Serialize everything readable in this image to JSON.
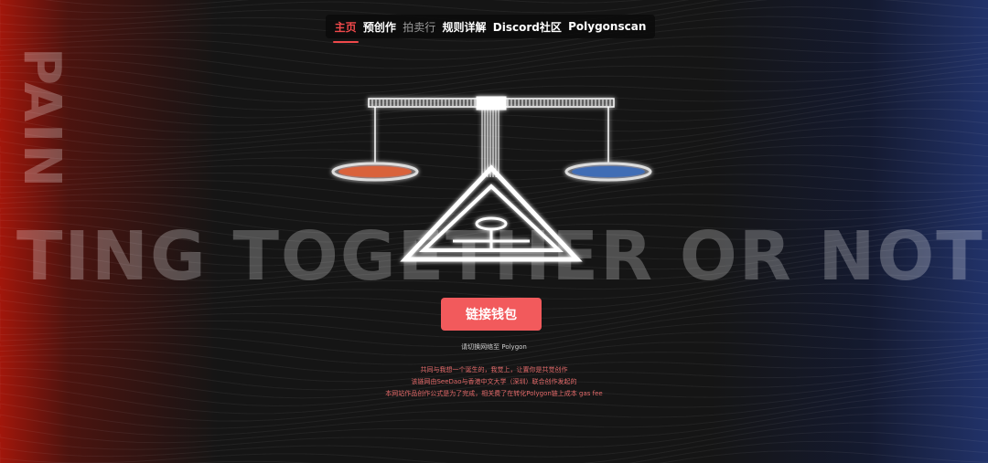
{
  "nav": {
    "items": [
      {
        "label": "主页",
        "state": "active"
      },
      {
        "label": "预创作",
        "state": "normal"
      },
      {
        "label": "拍卖行",
        "state": "dim"
      },
      {
        "label": "规则详解",
        "state": "normal"
      },
      {
        "label": "Discord社区",
        "state": "normal"
      },
      {
        "label": "Polygonscan",
        "state": "normal"
      }
    ]
  },
  "hero": {
    "vertical_text": "PAIN",
    "row_text": "TING  TOGETHER  OR  NOT",
    "left_pan_color": "#d9623a",
    "right_pan_color": "#3f6db5"
  },
  "cta": {
    "label": "链接钱包",
    "color": "#f25a5c"
  },
  "network_note": "请切换网络至 Polygon",
  "description": [
    "共同与我想一个诞生的，我觉上，让置你是共觉创作",
    "该链网由SeeDao与香港中文大学（深圳）联合创作发起的",
    "本网站作品创作公式是为了完成，相关费了在转化Polygon链上成本 gas fee"
  ]
}
